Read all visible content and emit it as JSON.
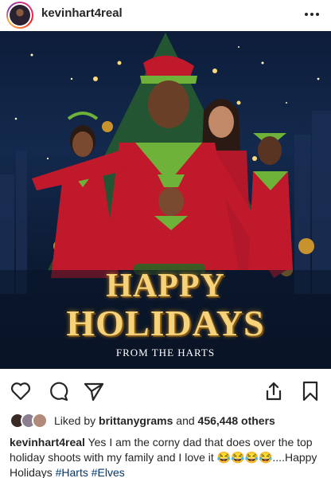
{
  "header": {
    "username": "kevinhart4real",
    "more_icon": "ellipsis-icon"
  },
  "post_image": {
    "title_line1": "HAPPY",
    "title_line2": "HOLIDAYS",
    "subtitle": "FROM THE HARTS"
  },
  "actions": {
    "like_icon": "heart-icon",
    "comment_icon": "comment-icon",
    "share_icon": "send-icon",
    "upload_icon": "share-upload-icon",
    "save_icon": "bookmark-icon"
  },
  "likes": {
    "prefix": "Liked by",
    "user": "brittanygrams",
    "conjunction": "and",
    "count_text": "456,448 others"
  },
  "caption": {
    "username": "kevinhart4real",
    "text": "Yes I am the corny dad that does over the top holiday shoots with my family and I love it 😂😂😂😂....Happy Holidays",
    "hashtags": [
      "#Harts",
      "#Elves"
    ]
  },
  "colors": {
    "text": "#262626",
    "hashtag": "#00376b",
    "gold": "#f6d27a",
    "elf_red": "#c0192b",
    "elf_green": "#6fb23a"
  }
}
